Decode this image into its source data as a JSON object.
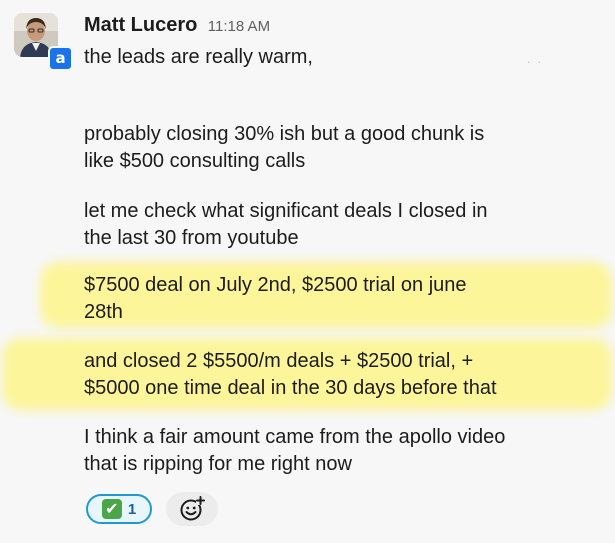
{
  "message": {
    "author": "Matt Lucero",
    "timestamp": "11:18 AM",
    "app_badge": "a",
    "lines": [
      "the leads are really warm,",
      "probably closing 30% ish but a good chunk is",
      "like $500 consulting calls",
      "let me check what significant deals I closed in",
      "the last 30 from youtube",
      "$7500 deal on July 2nd, $2500 trial on june",
      "28th",
      "and closed 2 $5500/m deals + $2500 trial, +",
      "$5000 one time deal in the 30 days before that",
      "I think a fair amount came from the apollo video",
      "that is ripping for me right now"
    ],
    "highlight_color": "#fcf59a"
  },
  "reactions": [
    {
      "emoji": "white-check-mark",
      "glyph": "✔",
      "count": "1"
    }
  ],
  "add_reaction": {
    "icon": "add-reaction-icon"
  },
  "colors": {
    "text": "#1d1c1d",
    "timestamp": "#616061",
    "reaction_border": "#1d9bd1",
    "reaction_bg": "#e8f5fa",
    "badge": "#1a73e8"
  }
}
